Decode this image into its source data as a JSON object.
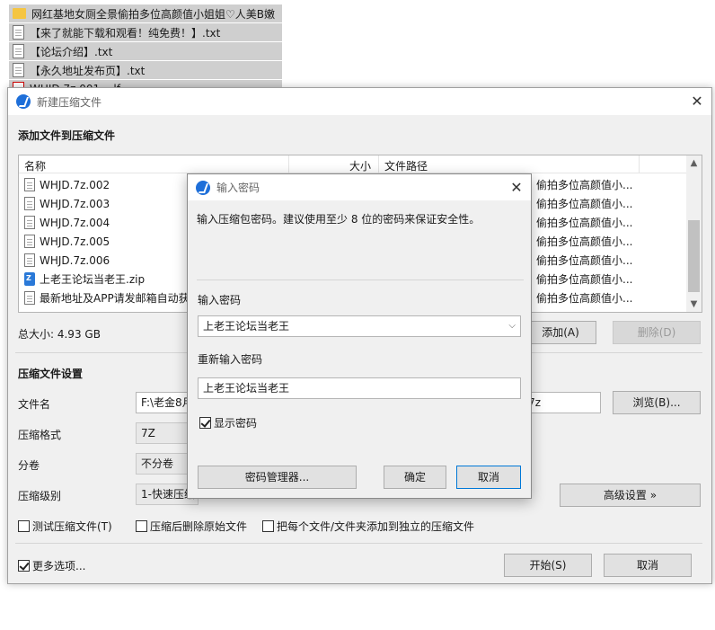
{
  "background_list": [
    {
      "icon": "folder-icon",
      "label": "网红基地女厕全景偷拍多位高颜值小姐姐♡人美B嫩"
    },
    {
      "icon": "text-file-icon",
      "label": "【来了就能下载和观看！纯免费！】.txt"
    },
    {
      "icon": "text-file-icon",
      "label": "【论坛介绍】.txt"
    },
    {
      "icon": "text-file-icon",
      "label": "【永久地址发布页】.txt"
    },
    {
      "icon": "pdf-file-icon",
      "label": "WHJD.7z.001....lf"
    }
  ],
  "main_window": {
    "title": "新建压缩文件",
    "add_files_heading": "添加文件到压缩文件",
    "columns": {
      "name": "名称",
      "size": "大小",
      "path": "文件路径"
    },
    "files": [
      {
        "icon": "text-file-icon",
        "name": "WHJD.7z.002",
        "path": "偷拍多位高颜值小..."
      },
      {
        "icon": "text-file-icon",
        "name": "WHJD.7z.003",
        "path": "偷拍多位高颜值小..."
      },
      {
        "icon": "text-file-icon",
        "name": "WHJD.7z.004",
        "path": "偷拍多位高颜值小..."
      },
      {
        "icon": "text-file-icon",
        "name": "WHJD.7z.005",
        "path": "偷拍多位高颜值小..."
      },
      {
        "icon": "text-file-icon",
        "name": "WHJD.7z.006",
        "path": "偷拍多位高颜值小..."
      },
      {
        "icon": "zip-file-icon",
        "name": "上老王论坛当老王.zip",
        "path": "偷拍多位高颜值小..."
      },
      {
        "icon": "text-file-icon",
        "name": "最新地址及APP请发邮箱自动获",
        "path": "偷拍多位高颜值小..."
      }
    ],
    "total_size": "总大小: 4.93 GB",
    "add_button": "添加(A)",
    "delete_button": "删除(D)",
    "settings_heading": "压缩文件设置",
    "filename_label": "文件名",
    "filename_value": "F:\\老金8月",
    "filename_value_suffix": "7z",
    "browse_button": "浏览(B)...",
    "format_label": "压缩格式",
    "format_value": "7Z",
    "split_label": "分卷",
    "split_value": "不分卷",
    "level_label": "压缩级别",
    "level_value": "1-快速压缩",
    "advanced_button": "高级设置 »",
    "test_checkbox": "测试压缩文件(T)",
    "delete_after_checkbox": "压缩后删除原始文件",
    "separate_checkbox": "把每个文件/文件夹添加到独立的压缩文件",
    "more_options_checkbox": "更多选项...",
    "start_button": "开始(S)",
    "cancel_button": "取消"
  },
  "password_dialog": {
    "title": "输入密码",
    "instruction": "输入压缩包密码。建议使用至少 8 位的密码来保证安全性。",
    "password_label": "输入密码",
    "password_value": "上老王论坛当老王",
    "confirm_label": "重新输入密码",
    "confirm_value": "上老王论坛当老王",
    "show_password_checkbox": "显示密码",
    "show_password_checked": true,
    "manager_button": "密码管理器...",
    "ok_button": "确定",
    "cancel_button": "取消"
  }
}
